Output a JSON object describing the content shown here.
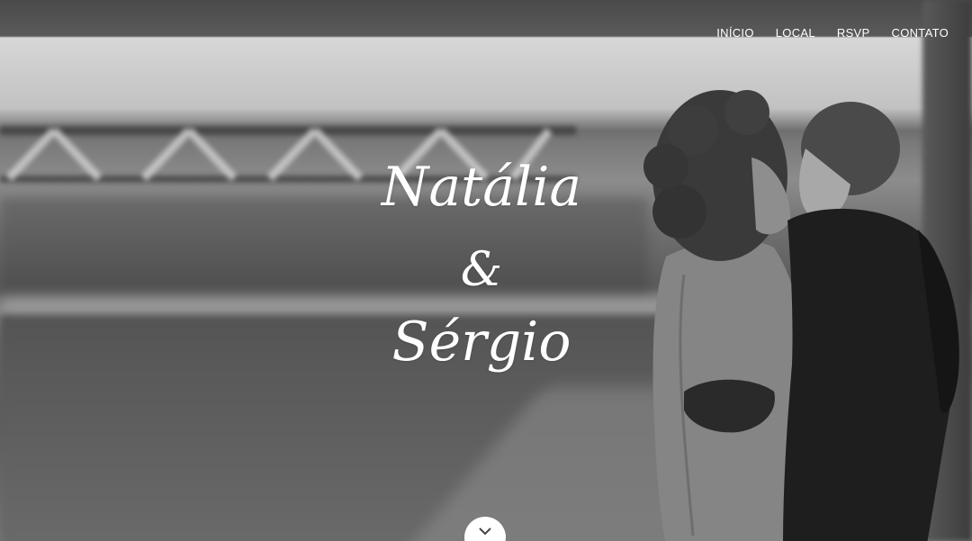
{
  "nav": {
    "items": [
      {
        "label": "INÍCIO"
      },
      {
        "label": "LOCAL"
      },
      {
        "label": "RSVP"
      },
      {
        "label": "CONTATO"
      }
    ]
  },
  "hero": {
    "name1": "Natália",
    "ampersand": "&",
    "name2": "Sérgio",
    "background": "black-and-white photo of a couple kissing by a river",
    "scroll_icon": "chevron-down-icon"
  },
  "colors": {
    "text": "#ffffff",
    "button_bg": "#ffffff",
    "icon": "#444444"
  }
}
